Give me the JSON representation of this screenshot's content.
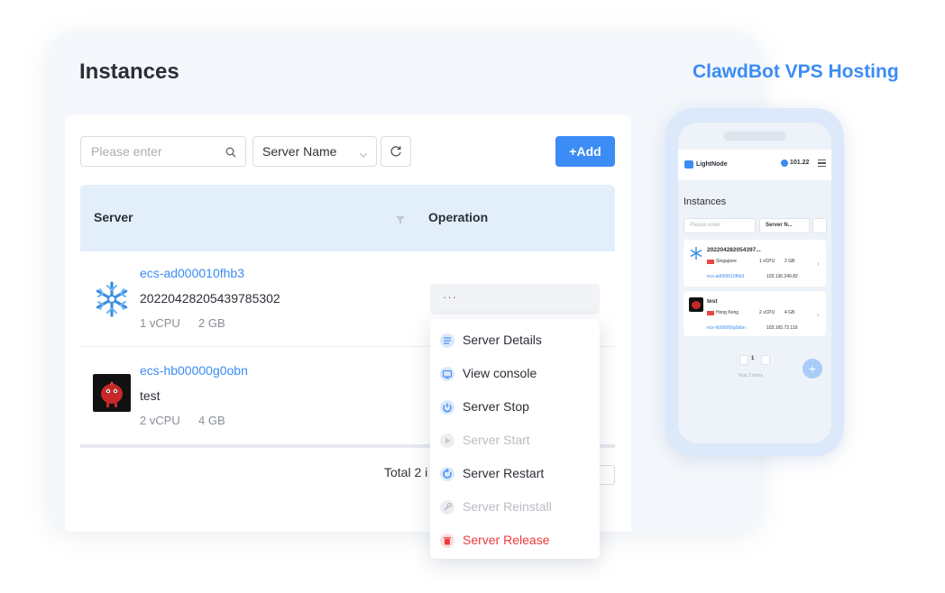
{
  "brand": "ClawdBot VPS Hosting",
  "page_title": "Instances",
  "toolbar": {
    "search_placeholder": "Please enter",
    "select_value": "Server Name",
    "add_label": "+Add"
  },
  "table": {
    "columns": [
      "Server",
      "Operation"
    ],
    "rows": [
      {
        "id": "ecs-ad000010fhb3",
        "name": "20220428205439785302",
        "cpu": "1 vCPU",
        "ram": "2 GB",
        "ops": "···"
      },
      {
        "id": "ecs-hb00000g0obn",
        "name": "test",
        "cpu": "2 vCPU",
        "ram": "4 GB"
      }
    ]
  },
  "pagination": {
    "total_text": "Total 2 i"
  },
  "menu": {
    "items": [
      {
        "label": "Server Details",
        "state": "enabled",
        "color": "#6fa6f0"
      },
      {
        "label": "View console",
        "state": "enabled",
        "color": "#6fa6f0"
      },
      {
        "label": "Server Stop",
        "state": "enabled",
        "color": "#4e95f2"
      },
      {
        "label": "Server Start",
        "state": "disabled",
        "color": "#cfd3d8"
      },
      {
        "label": "Server Restart",
        "state": "enabled",
        "color": "#4e95f2"
      },
      {
        "label": "Server Reinstall",
        "state": "disabled",
        "color": "#cfd3d8"
      },
      {
        "label": "Server Release",
        "state": "danger",
        "color": "#f03a3a"
      }
    ]
  },
  "phone": {
    "brand": "LightNode",
    "balance": "101.22",
    "title": "Instances",
    "search_placeholder": "Please enter",
    "select_value": "Server N...",
    "cards": [
      {
        "name": "202204282054397...",
        "location": "Singapore",
        "cpu": "1 vCPU",
        "ram": "2 GB",
        "id": "ecs-ad000010fhb3",
        "ip": "103.136.249.82"
      },
      {
        "name": "test",
        "location": "Hong Kong",
        "cpu": "2 vCPU",
        "ram": "4 GB",
        "id": "ecs-hb00000g0obn",
        "ip": "103.165.72.119"
      }
    ],
    "page": "1",
    "total": "Total 2 items"
  }
}
